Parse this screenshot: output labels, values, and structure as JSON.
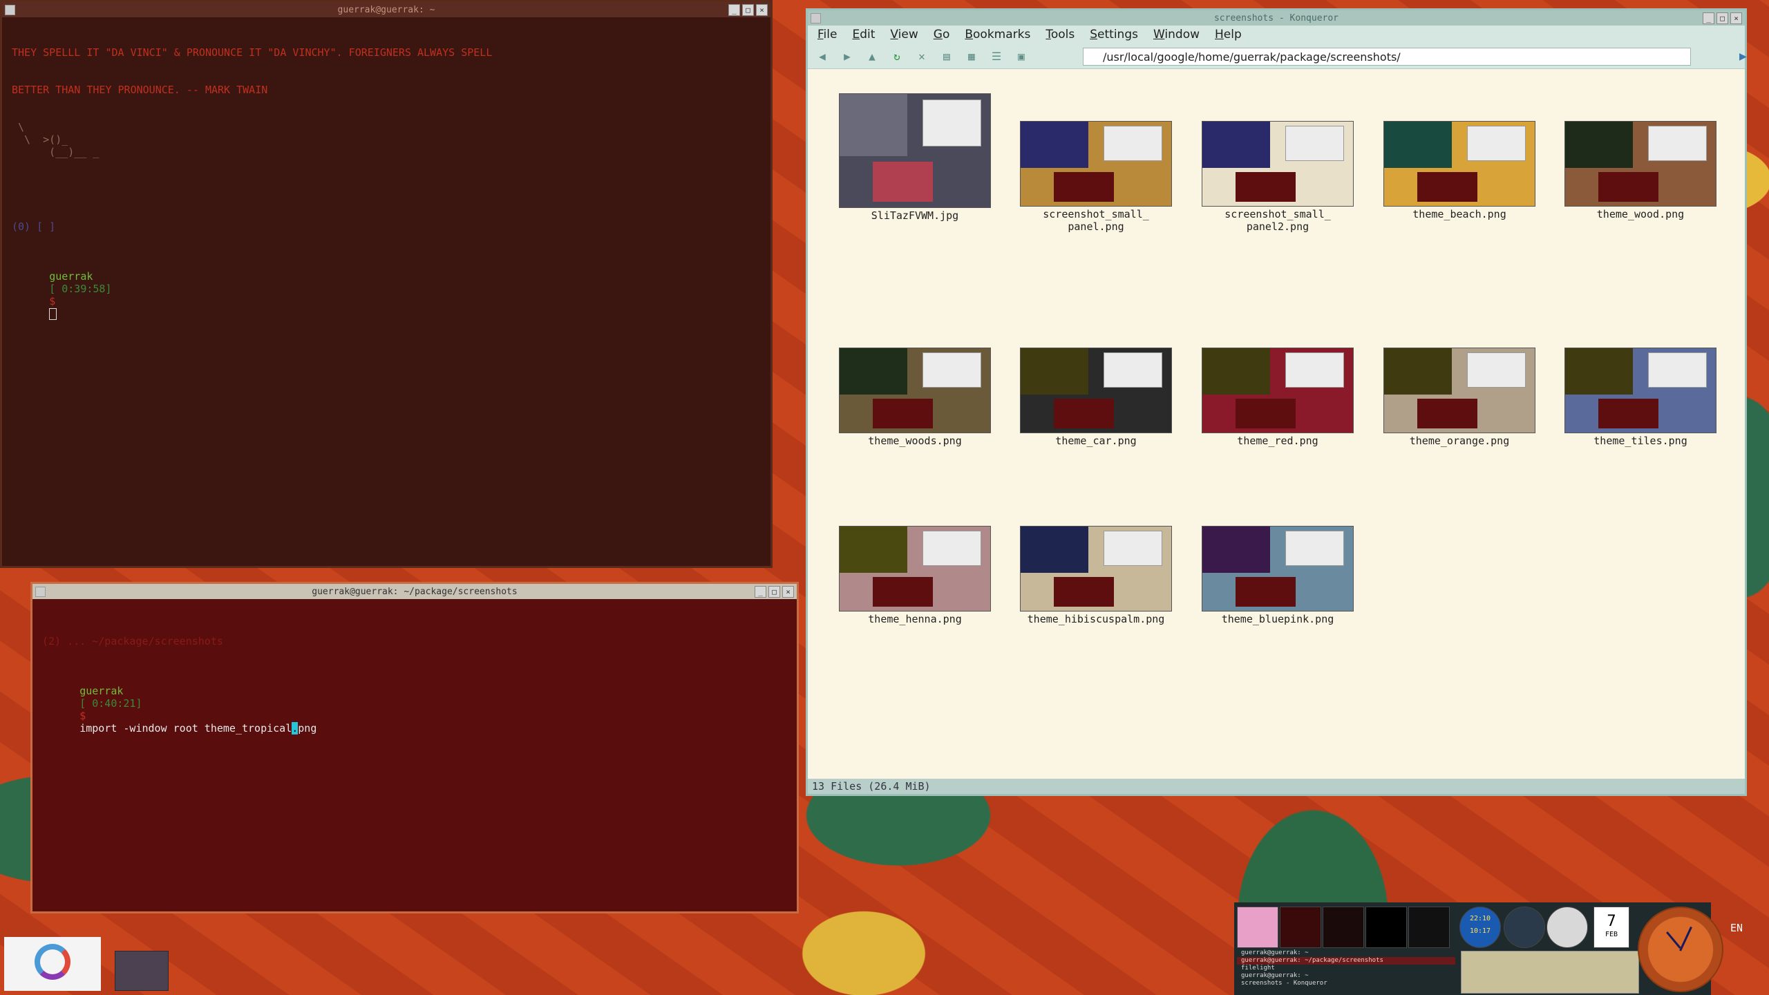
{
  "term1": {
    "title": "guerrak@guerrak: ~",
    "fortune_line1": "THEY SPELLL IT \"DA VINCI\" & PRONOUNCE IT \"DA VINCHY\". FOREIGNERS ALWAYS SPELL",
    "fortune_line2": "BETTER THAN THEY PRONOUNCE. -- MARK TWAIN",
    "cow": " \\\n  \\  >()_\n      (__)__ _",
    "status_line": "(0) [ ]",
    "prompt_user": "guerrak",
    "prompt_time": "[ 0:39:58]",
    "prompt_symbol": "$"
  },
  "term2": {
    "title": "guerrak@guerrak: ~/package/screenshots",
    "status_line": "(2) ... ~/package/screenshots",
    "prompt_user": "guerrak",
    "prompt_time": "[ 0:40:21]",
    "prompt_symbol": "$",
    "command_before": "import -window root theme_tropical",
    "command_after": "png"
  },
  "konqueror": {
    "title": "screenshots - Konqueror",
    "menu": [
      "File",
      "Edit",
      "View",
      "Go",
      "Bookmarks",
      "Tools",
      "Settings",
      "Window",
      "Help"
    ],
    "location": "/usr/local/google/home/guerrak/package/screenshots/",
    "files": [
      {
        "name": "SliTazFVWM.jpg",
        "colors": [
          "#6a6a7a",
          "#dcdcdc",
          "#b04050"
        ]
      },
      {
        "name": "screenshot_small_\npanel.png",
        "colors": [
          "#2a2a6a",
          "#ececec",
          "#5e0e0e"
        ]
      },
      {
        "name": "screenshot_small_\npanel2.png",
        "colors": [
          "#2a2a6a",
          "#ececec",
          "#5e0e0e"
        ]
      },
      {
        "name": "theme_beach.png",
        "colors": [
          "#184a40",
          "#ececec",
          "#5e0e0e"
        ]
      },
      {
        "name": "theme_wood.png",
        "colors": [
          "#1e2a1a",
          "#ececec",
          "#5e0e0e"
        ]
      },
      {
        "name": "theme_woods.png",
        "colors": [
          "#1e2e1a",
          "#ececec",
          "#5e0e0e"
        ]
      },
      {
        "name": "theme_car.png",
        "colors": [
          "#3f3a10",
          "#ececec",
          "#5e0e0e"
        ]
      },
      {
        "name": "theme_red.png",
        "colors": [
          "#3f3a10",
          "#ececec",
          "#5e0e0e"
        ]
      },
      {
        "name": "theme_orange.png",
        "colors": [
          "#3f3a10",
          "#ececec",
          "#5e0e0e"
        ]
      },
      {
        "name": "theme_tiles.png",
        "colors": [
          "#3f3a10",
          "#ececec",
          "#5e0e0e"
        ]
      },
      {
        "name": "theme_henna.png",
        "colors": [
          "#4a4a10",
          "#ececec",
          "#5e0e0e"
        ]
      },
      {
        "name": "theme_hibiscuspalm.png",
        "colors": [
          "#1e2650",
          "#ececec",
          "#5e0e0e"
        ]
      },
      {
        "name": "theme_bluepink.png",
        "colors": [
          "#3a1a4a",
          "#ececec",
          "#5e0e0e"
        ]
      }
    ],
    "status": "13 Files (26.4 MiB)"
  },
  "panel": {
    "tasks": [
      "guerrak@guerrak: ~",
      "guerrak@guerrak: ~/package/screenshots",
      "filelight",
      "guerrak@guerrak: ~",
      "screenshots - Konqueror"
    ],
    "clock_time_1": "22:10",
    "clock_time_2": "10:17",
    "calendar_day": "7",
    "calendar_month": "FEB",
    "lang": "EN"
  },
  "colors": {
    "term1_bg": "#3b1510",
    "term2_bg": "#5a0d0d",
    "konq_bg": "#fbf6e3",
    "prompt_green": "#6fbf3a",
    "fortune_red": "#c0301f"
  }
}
